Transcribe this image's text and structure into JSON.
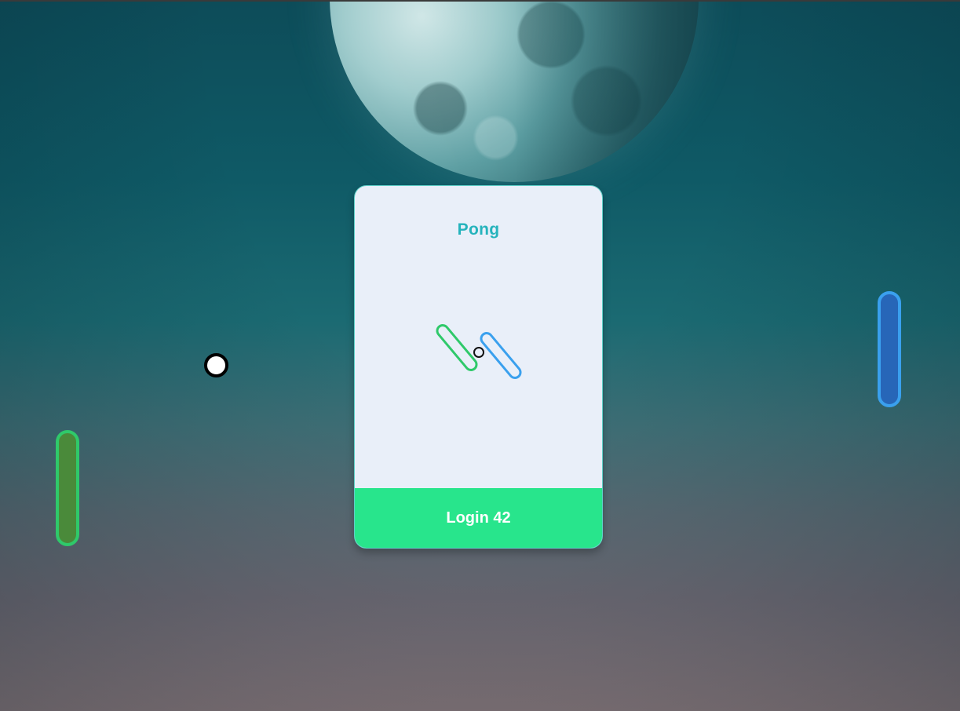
{
  "card": {
    "title": "Pong",
    "login_label": "Login 42",
    "logo_icon": "pong-logo-icon"
  },
  "colors": {
    "title": "#25b3bc",
    "login_button": "#28e58c",
    "left_paddle_fill": "#4a8a3a",
    "left_paddle_border": "#2fc96a",
    "right_paddle_fill": "#2766b8",
    "right_paddle_border": "#3aa0ee",
    "ball": "#ffffff"
  }
}
